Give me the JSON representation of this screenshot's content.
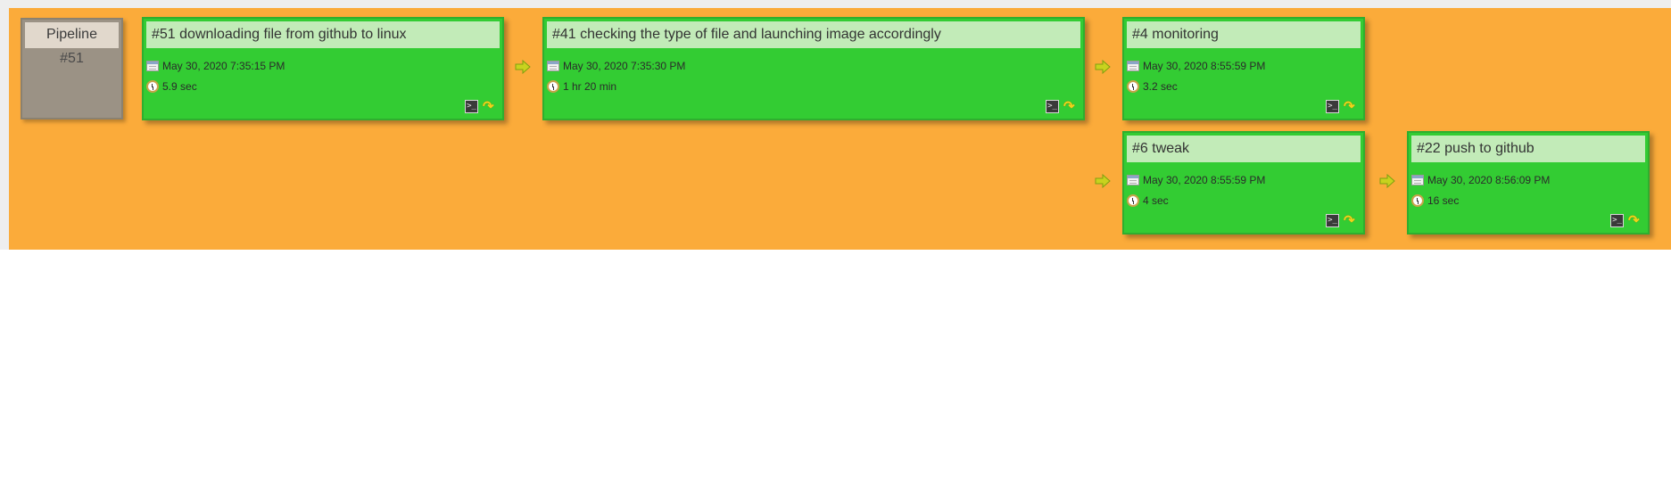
{
  "pipeline": {
    "title": "Pipeline",
    "number": "#51"
  },
  "builds": [
    {
      "title": "#51 downloading file from github to linux",
      "date": "May 30, 2020 7:35:15 PM",
      "duration": "5.9 sec"
    },
    {
      "title": "#41 checking the type of file and launching image accordingly",
      "date": "May 30, 2020 7:35:30 PM",
      "duration": "1 hr 20 min"
    },
    {
      "title": "#4 monitoring",
      "date": "May 30, 2020 8:55:59 PM",
      "duration": "3.2 sec"
    },
    {
      "title": "#6 tweak",
      "date": "May 30, 2020 8:55:59 PM",
      "duration": "4 sec"
    },
    {
      "title": "#22 push to github",
      "date": "May 30, 2020 8:56:09 PM",
      "duration": "16 sec"
    }
  ],
  "icons": {
    "date": "calendar-icon",
    "duration": "clock-icon",
    "console": "console-icon",
    "rerun": "rerun-icon",
    "flow": "flow-arrow-icon"
  },
  "colors": {
    "canvas": "#fbab3a",
    "build_success": "#33cc33",
    "build_title_bg": "#c2ebb8",
    "pipeline_box": "#9b9285"
  }
}
